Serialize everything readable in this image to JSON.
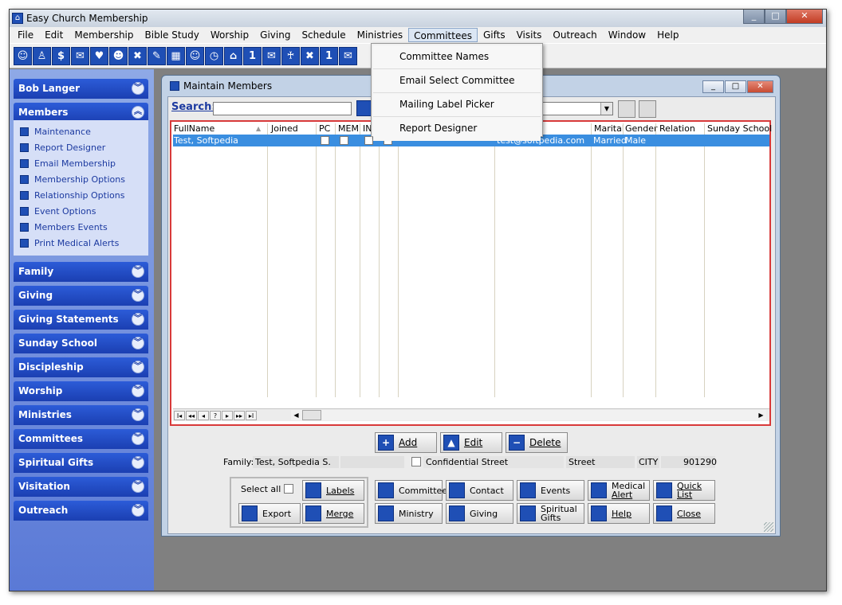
{
  "window": {
    "title": "Easy Church Membership"
  },
  "menu": [
    "File",
    "Edit",
    "Membership",
    "Bible Study",
    "Worship",
    "Giving",
    "Schedule",
    "Ministries",
    "Committees",
    "Gifts",
    "Visits",
    "Outreach",
    "Window",
    "Help"
  ],
  "committees_menu": [
    "Committee Names",
    "Email Select Committee",
    "Mailing Label Picker",
    "Report Designer"
  ],
  "sidebar": {
    "user": "Bob Langer",
    "members_group": "Members",
    "members_items": [
      "Maintenance",
      "Report Designer",
      "Email Membership",
      "Membership Options",
      "Relationship Options",
      "Event Options",
      "Members Events",
      "Print Medical Alerts"
    ],
    "groups": [
      "Family",
      "Giving",
      "Giving Statements",
      "Sunday School",
      "Discipleship",
      "Worship",
      "Ministries",
      "Committees",
      "Spiritual Gifts",
      "Visitation",
      "Outreach"
    ]
  },
  "maintain": {
    "title": "Maintain Members",
    "search_label": "Search:",
    "headers": [
      "FullName",
      "Joined",
      "PC",
      "MEM",
      "IN",
      "Marital",
      "Gender",
      "Relation",
      "Sunday School"
    ],
    "row": {
      "fullname": "Test, Softpedia",
      "email": "test@softpedia.com",
      "marital": "Married",
      "gender": "Male"
    },
    "nav": [
      "I◂",
      "◂◂",
      "◂",
      "?",
      "▸",
      "▸▸",
      "▸I"
    ],
    "actions": {
      "add": "Add",
      "edit": "Edit",
      "delete": "Delete"
    },
    "family": {
      "label": "Family:",
      "name": "Test, Softpedia S.",
      "confidential": "Confidential Street",
      "street_label": "Street",
      "city": "CITY",
      "zip": "901290"
    },
    "select_all": "Select all",
    "buttons": {
      "labels": "Labels",
      "export": "Export",
      "merge": "Merge",
      "committee": "Committee",
      "contact": "Contact",
      "events": "Events",
      "medical_l1": "Medical",
      "medical_l2": "Alert",
      "quick_l1": "Quick",
      "quick_l2": "List",
      "ministry": "Ministry",
      "giving": "Giving",
      "spiritual_l1": "Spiritual",
      "spiritual_l2": "Gifts",
      "help": "Help",
      "close": "Close"
    }
  }
}
